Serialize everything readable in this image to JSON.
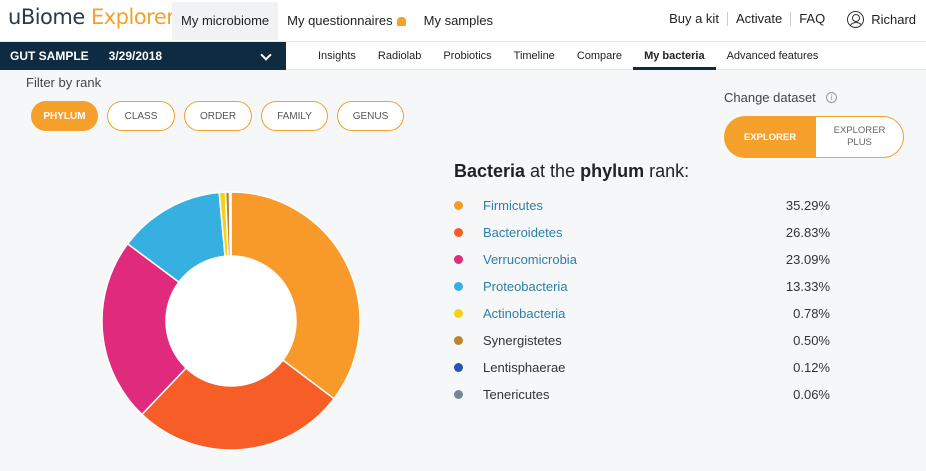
{
  "app": {
    "logo_u": "u",
    "logo_biome": "Biome",
    "logo_explorer": "Explorer"
  },
  "topnav": {
    "items": [
      {
        "label": "My microbiome",
        "active": true
      },
      {
        "label": "My questionnaires",
        "active": false
      },
      {
        "label": "My samples",
        "active": false
      }
    ],
    "right": [
      "Buy a kit",
      "Activate",
      "FAQ"
    ],
    "user": "Richard"
  },
  "sample": {
    "label": "GUT SAMPLE",
    "date": "3/29/2018"
  },
  "subnav": {
    "items": [
      "Insights",
      "Radiolab",
      "Probiotics",
      "Timeline",
      "Compare",
      "My bacteria",
      "Advanced features"
    ],
    "active": "My bacteria"
  },
  "filter": {
    "label": "Filter by rank",
    "ranks": [
      "PHYLUM",
      "CLASS",
      "ORDER",
      "FAMILY",
      "GENUS"
    ],
    "active": "PHYLUM"
  },
  "dataset": {
    "label": "Change dataset",
    "info_icon": "i",
    "options": [
      "EXPLORER",
      "EXPLORER PLUS"
    ],
    "active": "EXPLORER"
  },
  "heading": {
    "bold1": "Bacteria",
    "mid": " at the ",
    "bold2": "phylum",
    "end": " rank:"
  },
  "chart_data": {
    "type": "pie",
    "variant": "donut",
    "categories": [
      "Firmicutes",
      "Bacteroidetes",
      "Verrucomicrobia",
      "Proteobacteria",
      "Actinobacteria",
      "Synergistetes",
      "Lentisphaerae",
      "Tenericutes"
    ],
    "values": [
      35.29,
      26.83,
      23.09,
      13.33,
      0.78,
      0.5,
      0.12,
      0.06
    ],
    "labels": [
      "35.29%",
      "26.83%",
      "23.09%",
      "13.33%",
      "0.78%",
      "0.50%",
      "0.12%",
      "0.06%"
    ],
    "colors": [
      "#f89a2a",
      "#f75d26",
      "#e02a7c",
      "#36b0e0",
      "#f5d21a",
      "#b7862e",
      "#2653b8",
      "#7a8696"
    ],
    "linked": [
      true,
      true,
      true,
      true,
      true,
      false,
      false,
      false
    ],
    "legend": "right"
  }
}
